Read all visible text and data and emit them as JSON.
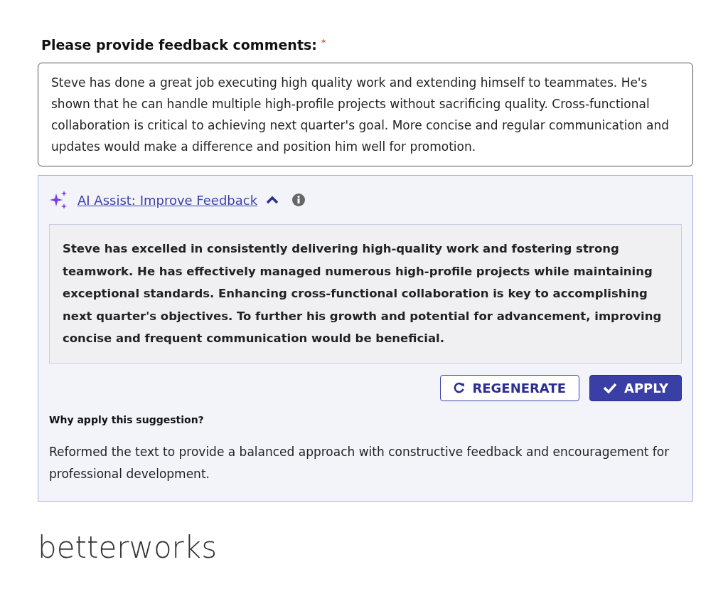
{
  "question": {
    "label": "Please provide feedback comments:",
    "required_mark": "*"
  },
  "comment_field": {
    "value": "Steve has done a great job executing high quality work and extending himself to teammates. He's shown that he can handle multiple high-profile projects without sacrificing quality. Cross-functional collaboration is critical to achieving next quarter's goal. More concise and regular communication and updates would make a difference and position him well for promotion."
  },
  "ai_assist": {
    "link": "AI Assist: Improve Feedback",
    "expanded": true,
    "suggestion": "Steve has excelled in consistently delivering high-quality work and fostering strong teamwork. He has effectively managed numerous high-profile projects while maintaining exceptional standards. Enhancing cross-functional collaboration is key to accomplishing next quarter's objectives. To further his growth and potential for advancement, improving concise and frequent communication would be beneficial.",
    "buttons": [
      {
        "label": "REGENERATE",
        "kind": "secondary"
      },
      {
        "label": "APPLY",
        "kind": "primary"
      }
    ],
    "why_heading": "Why apply this suggestion?",
    "why_text": "Reformed the text to provide a balanced approach with constructive feedback and encouragement for professional development."
  },
  "logo": "betterworks"
}
